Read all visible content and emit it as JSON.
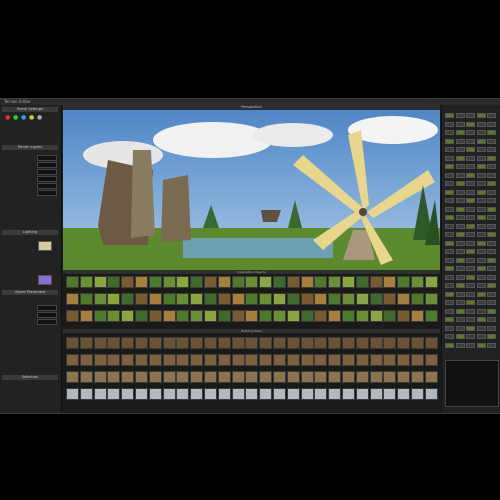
{
  "window": {
    "title": "Terrain Editor"
  },
  "viewport": {
    "title": "Perspective"
  },
  "left_panel": {
    "sections": [
      {
        "header": "Brush Settings"
      },
      {
        "header": "Terrain Layers"
      },
      {
        "header": "Lighting"
      },
      {
        "header": "Object Placement"
      },
      {
        "header": "Selection"
      }
    ]
  },
  "browser": {
    "vegetation_header": "Vegetation Objects",
    "tiles_header": "Building Tiles"
  },
  "colors": {
    "panel": "#222222",
    "accent_green": "#5a7a2a",
    "sky_top": "#5b8fc9",
    "grass": "#5d8a2e"
  }
}
